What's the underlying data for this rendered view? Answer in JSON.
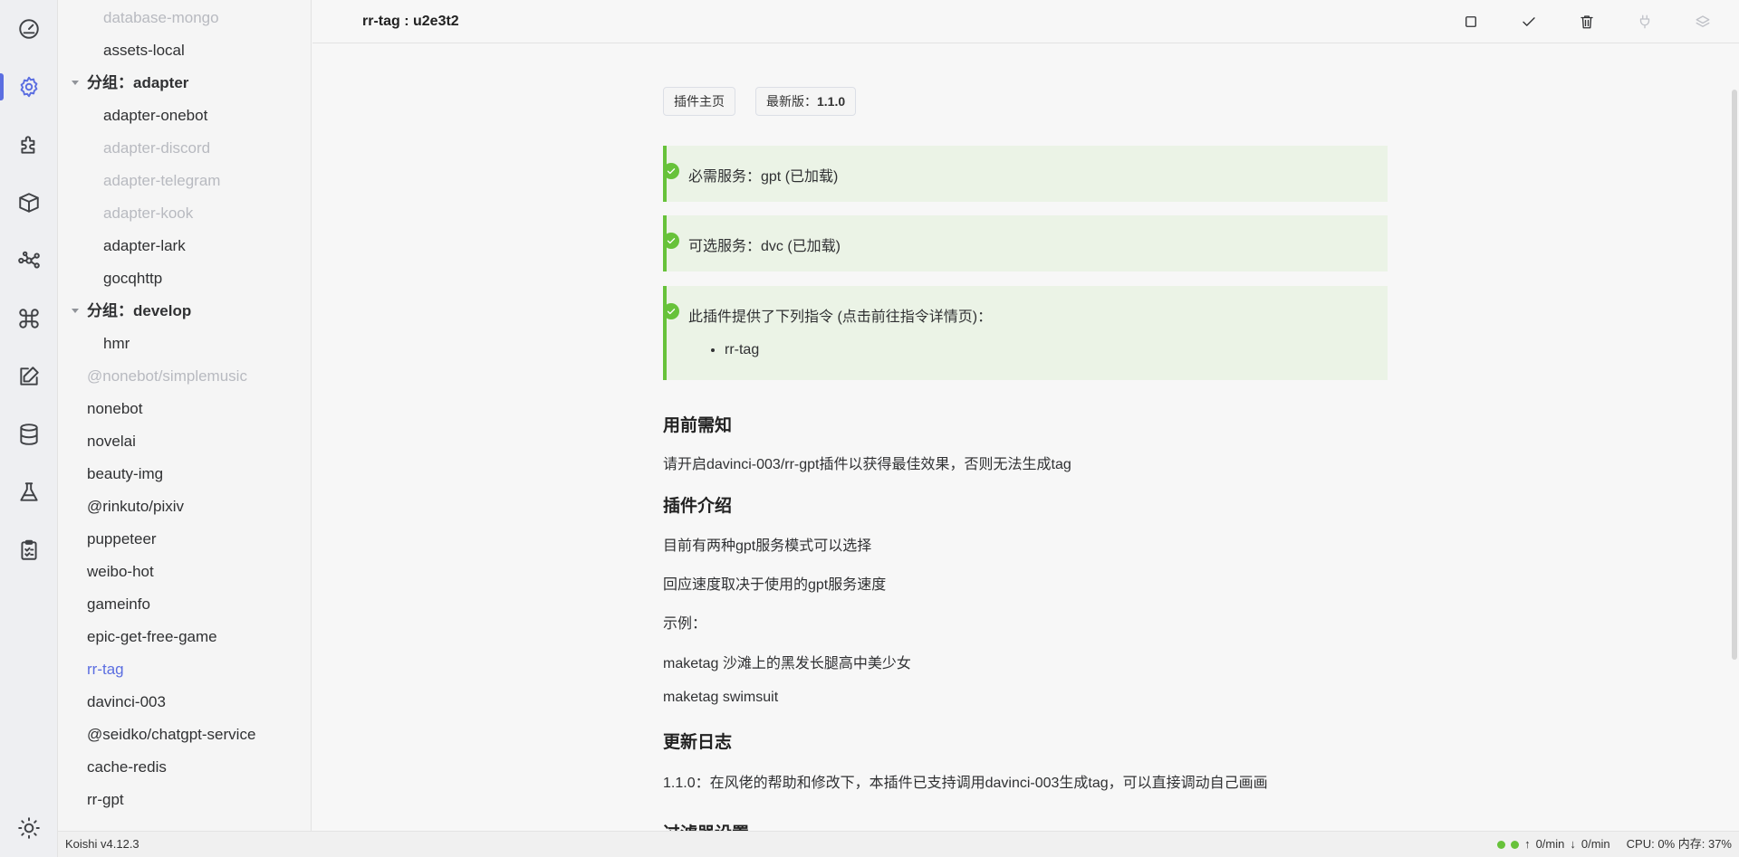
{
  "activity_bar": {
    "items": [
      {
        "icon": "dashboard-icon",
        "active": false
      },
      {
        "icon": "gear-icon",
        "active": true
      },
      {
        "icon": "puzzle-icon",
        "active": false
      },
      {
        "icon": "box-icon",
        "active": false
      },
      {
        "icon": "network-icon",
        "active": false
      },
      {
        "icon": "command-icon",
        "active": false
      },
      {
        "icon": "edit-icon",
        "active": false
      },
      {
        "icon": "database-icon",
        "active": false
      },
      {
        "icon": "flask-icon",
        "active": false
      },
      {
        "icon": "clipboard-icon",
        "active": false
      }
    ],
    "bottom_icon": "sun-icon",
    "accent_color": "#5b6ee1"
  },
  "sidebar": {
    "items": [
      {
        "label": "database-mongo",
        "level": 2,
        "state": "disabled"
      },
      {
        "label": "assets-local",
        "level": 2,
        "state": "normal"
      },
      {
        "label": "分组：adapter",
        "level": 1,
        "state": "group"
      },
      {
        "label": "adapter-onebot",
        "level": 2,
        "state": "normal"
      },
      {
        "label": "adapter-discord",
        "level": 2,
        "state": "disabled"
      },
      {
        "label": "adapter-telegram",
        "level": 2,
        "state": "disabled"
      },
      {
        "label": "adapter-kook",
        "level": 2,
        "state": "disabled"
      },
      {
        "label": "adapter-lark",
        "level": 2,
        "state": "normal"
      },
      {
        "label": "gocqhttp",
        "level": 2,
        "state": "normal"
      },
      {
        "label": "分组：develop",
        "level": 1,
        "state": "group"
      },
      {
        "label": "hmr",
        "level": 2,
        "state": "normal"
      },
      {
        "label": "@nonebot/simplemusic",
        "level": 1,
        "state": "disabled"
      },
      {
        "label": "nonebot",
        "level": 1,
        "state": "normal"
      },
      {
        "label": "novelai",
        "level": 1,
        "state": "normal"
      },
      {
        "label": "beauty-img",
        "level": 1,
        "state": "normal"
      },
      {
        "label": "@rinkuto/pixiv",
        "level": 1,
        "state": "normal"
      },
      {
        "label": "puppeteer",
        "level": 1,
        "state": "normal"
      },
      {
        "label": "weibo-hot",
        "level": 1,
        "state": "normal"
      },
      {
        "label": "gameinfo",
        "level": 1,
        "state": "normal"
      },
      {
        "label": "epic-get-free-game",
        "level": 1,
        "state": "normal"
      },
      {
        "label": "rr-tag",
        "level": 1,
        "state": "active"
      },
      {
        "label": "davinci-003",
        "level": 1,
        "state": "normal"
      },
      {
        "label": "@seidko/chatgpt-service",
        "level": 1,
        "state": "normal"
      },
      {
        "label": "cache-redis",
        "level": 1,
        "state": "normal"
      },
      {
        "label": "rr-gpt",
        "level": 1,
        "state": "normal"
      }
    ]
  },
  "header": {
    "title": "rr-tag : u2e3t2",
    "tools": [
      {
        "icon": "square-icon",
        "disabled": false
      },
      {
        "icon": "check-icon",
        "disabled": false
      },
      {
        "icon": "trash-icon",
        "disabled": false
      },
      {
        "icon": "plug-icon",
        "disabled": true
      },
      {
        "icon": "layers-icon",
        "disabled": true
      }
    ]
  },
  "main": {
    "homepage_button": "插件主页",
    "version_button_prefix": "最新版：",
    "version_button_value": "1.1.0",
    "notices": [
      {
        "text": "必需服务：gpt (已加载)"
      },
      {
        "text": "可选服务：dvc (已加载)"
      },
      {
        "text": "此插件提供了下列指令 (点击前往指令详情页)：",
        "list": [
          "rr-tag"
        ]
      }
    ],
    "sections": [
      {
        "heading": "用前需知"
      },
      {
        "paragraph": "请开启davinci-003/rr-gpt插件以获得最佳效果，否则无法生成tag"
      },
      {
        "heading": "插件介绍"
      },
      {
        "paragraph": "目前有两种gpt服务模式可以选择"
      },
      {
        "paragraph": "回应速度取决于使用的gpt服务速度"
      },
      {
        "paragraph": "示例："
      },
      {
        "paragraph": "maketag 沙滩上的黑发长腿高中美少女"
      },
      {
        "paragraph": "maketag swimsuit"
      },
      {
        "heading": "更新日志"
      },
      {
        "paragraph": "1.1.0：在风佬的帮助和修改下，本插件已支持调用davinci-003生成tag，可以直接调动自己画画"
      },
      {
        "heading": "过滤器设置"
      }
    ],
    "notice_color": "#67c23a"
  },
  "status_bar": {
    "version": "Koishi v4.12.3",
    "upload": "0/min",
    "download": "0/min",
    "cpu_mem": "CPU: 0% 内存: 37%"
  }
}
